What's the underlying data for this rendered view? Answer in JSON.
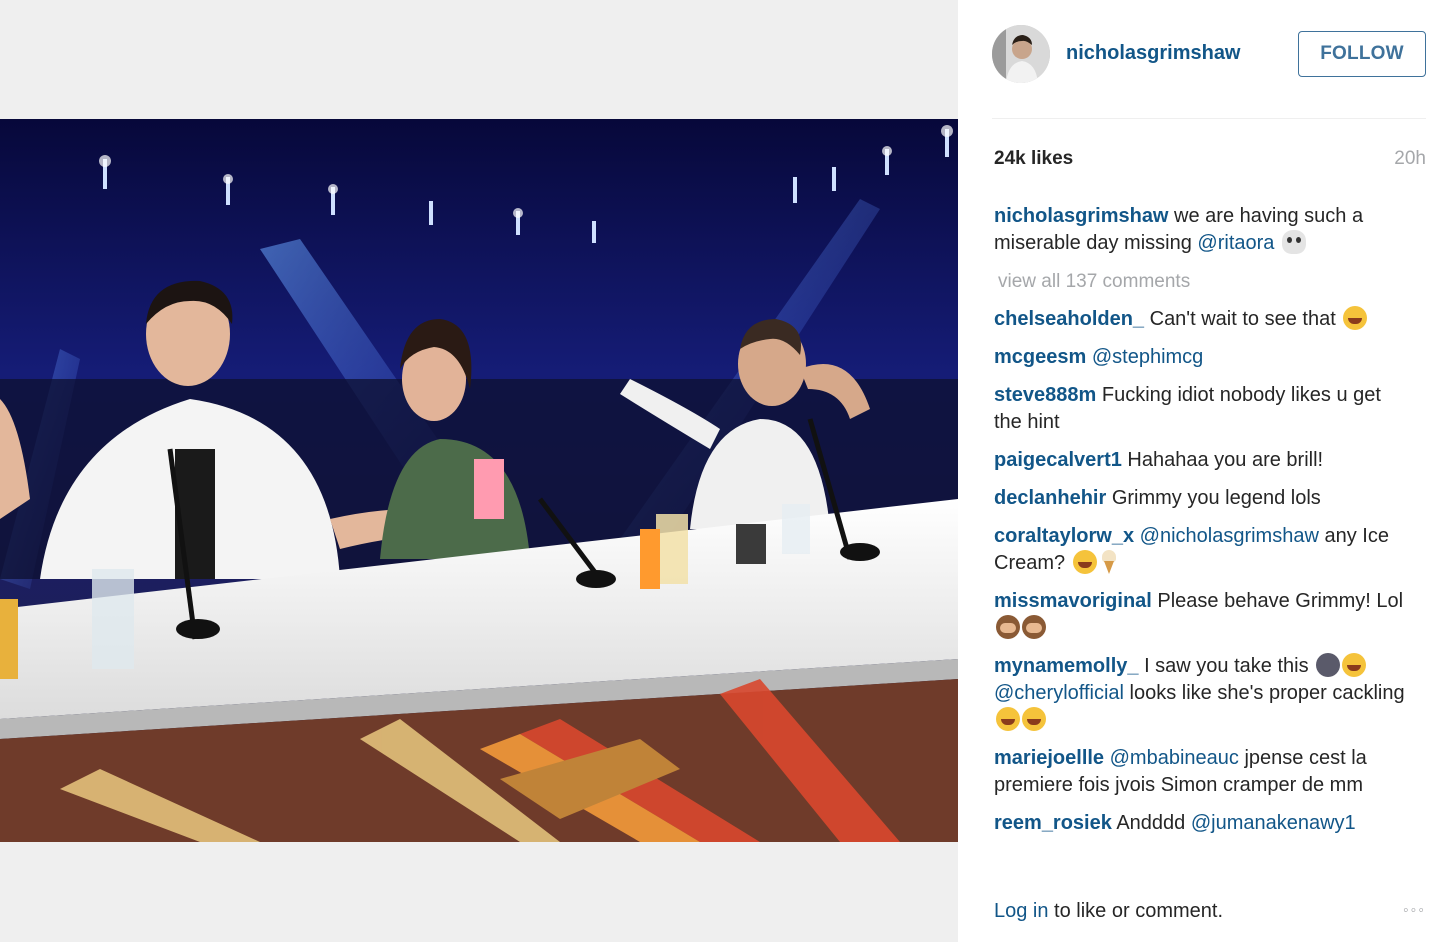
{
  "post": {
    "username": "nicholasgrimshaw",
    "follow_label": "FOLLOW",
    "likes": "24k likes",
    "time_ago": "20h",
    "caption": {
      "user": "nicholasgrimshaw",
      "text_before": " we are having such a miserable day missing ",
      "mention": "@ritaora",
      "emoji": "skull"
    },
    "view_all": "view all 137 comments"
  },
  "comments": [
    {
      "user": "chelseaholden_",
      "parts": [
        {
          "t": " Can't wait to see that "
        },
        {
          "e": "laugh"
        }
      ]
    },
    {
      "user": "mcgeesm",
      "parts": [
        {
          "t": " "
        },
        {
          "m": "@stephimcg"
        }
      ]
    },
    {
      "user": "steve888m",
      "parts": [
        {
          "t": " Fucking idiot nobody likes u get the hint"
        }
      ]
    },
    {
      "user": "paigecalvert1",
      "parts": [
        {
          "t": " Hahahaa you are brill!"
        }
      ]
    },
    {
      "user": "declanhehir",
      "parts": [
        {
          "t": " Grimmy you legend lols"
        }
      ]
    },
    {
      "user": "coraltaylorw_x",
      "parts": [
        {
          "t": " "
        },
        {
          "m": "@nicholasgrimshaw"
        },
        {
          "t": " any Ice Cream? "
        },
        {
          "e": "laugh"
        },
        {
          "e": "icecream"
        }
      ]
    },
    {
      "user": "missmavoriginal",
      "parts": [
        {
          "t": " Please behave Grimmy! Lol "
        },
        {
          "e": "monkey"
        },
        {
          "e": "monkey"
        }
      ]
    },
    {
      "user": "mynamemolly_",
      "parts": [
        {
          "t": " I saw you take this "
        },
        {
          "e": "moon"
        },
        {
          "e": "laugh"
        },
        {
          "t": " "
        },
        {
          "m": "@cherylofficial"
        },
        {
          "t": " looks like she's proper cackling "
        },
        {
          "e": "laugh"
        },
        {
          "e": "laugh"
        }
      ]
    },
    {
      "user": "mariejoellle",
      "parts": [
        {
          "t": " "
        },
        {
          "m": "@mbabineauc"
        },
        {
          "t": " jpense cest la premiere fois jvois Simon cramper de mm"
        }
      ]
    },
    {
      "user": "reem_rosiek",
      "parts": [
        {
          "t": " Andddd "
        },
        {
          "m": "@jumanakenawy1"
        }
      ]
    }
  ],
  "footer": {
    "login": "Log in",
    "rest": " to like or comment.",
    "more": "◦◦◦"
  }
}
